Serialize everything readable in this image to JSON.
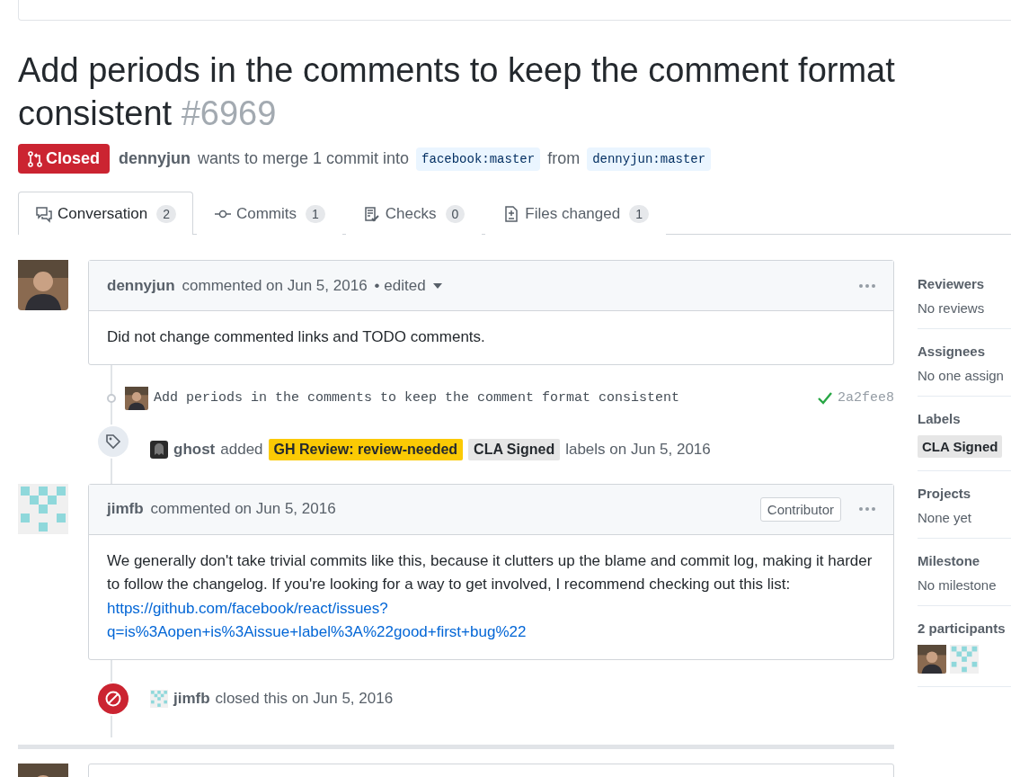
{
  "title": "Add periods in the comments to keep the comment format consistent",
  "number": "#6969",
  "state": {
    "kind": "closed",
    "label": "Closed"
  },
  "merge_info": {
    "author": "dennyjun",
    "text": "wants to merge 1 commit into",
    "base": "facebook:master",
    "from": "from",
    "head": "dennyjun:master"
  },
  "tabs": [
    {
      "label": "Conversation",
      "count": "2",
      "selected": true
    },
    {
      "label": "Commits",
      "count": "1",
      "selected": false
    },
    {
      "label": "Checks",
      "count": "0",
      "selected": false
    },
    {
      "label": "Files changed",
      "count": "1",
      "selected": false
    }
  ],
  "timeline": [
    {
      "kind": "comment",
      "author": "dennyjun",
      "action": "commented on Jun 5, 2016",
      "edited": "• edited",
      "body": "Did not change commented links and TODO comments."
    },
    {
      "kind": "commit",
      "message": "Add periods in the comments to keep the comment format consistent",
      "sha": "2a2fee8"
    },
    {
      "kind": "labeled",
      "actor": "ghost",
      "action": "added",
      "labels": [
        {
          "name": "GH Review: review-needed",
          "color": "#fbca04"
        },
        {
          "name": "CLA Signed",
          "color": "#e6e6e6"
        }
      ],
      "suffix": "labels on Jun 5, 2016"
    },
    {
      "kind": "comment",
      "author": "jimfb",
      "action": "commented on Jun 5, 2016",
      "badge": "Contributor",
      "body": "We generally don't take trivial commits like this, because it clutters up the blame and commit log, making it harder to follow the changelog. If you're looking for a way to get involved, I recommend checking out this list:",
      "link_lines": [
        "https://github.com/facebook/react/issues?",
        "q=is%3Aopen+is%3Aissue+label%3A%22good+first+bug%22"
      ]
    },
    {
      "kind": "closed",
      "actor": "jimfb",
      "text": "closed this on Jun 5, 2016"
    }
  ],
  "sidebar": [
    {
      "kind": "text",
      "heading": "Reviewers",
      "value": "No reviews"
    },
    {
      "kind": "text",
      "heading": "Assignees",
      "value": "No one assign"
    },
    {
      "kind": "labels",
      "heading": "Labels",
      "labels": [
        {
          "name": "CLA Signed",
          "color": "#e6e6e6"
        }
      ]
    },
    {
      "kind": "text",
      "heading": "Projects",
      "value": "None yet"
    },
    {
      "kind": "text",
      "heading": "Milestone",
      "value": "No milestone"
    },
    {
      "kind": "participants",
      "heading": "2 participants"
    }
  ]
}
